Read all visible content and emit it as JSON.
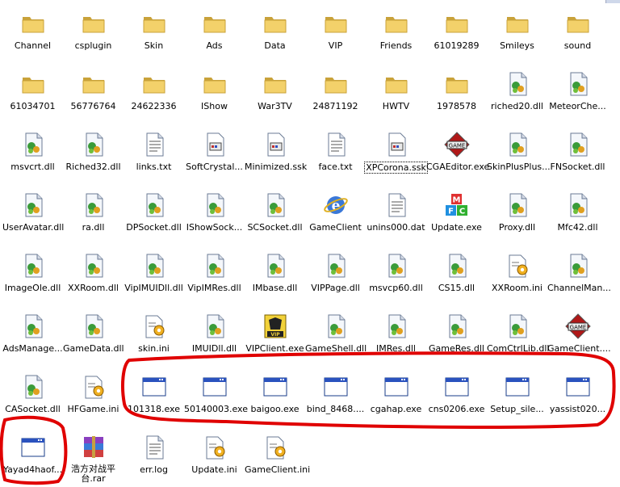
{
  "icons": [
    {
      "name": "Channel",
      "type": "folder"
    },
    {
      "name": "csplugin",
      "type": "folder"
    },
    {
      "name": "Skin",
      "type": "folder"
    },
    {
      "name": "Ads",
      "type": "folder"
    },
    {
      "name": "Data",
      "type": "folder"
    },
    {
      "name": "VIP",
      "type": "folder"
    },
    {
      "name": "Friends",
      "type": "folder"
    },
    {
      "name": "61019289",
      "type": "folder"
    },
    {
      "name": "Smileys",
      "type": "folder"
    },
    {
      "name": "sound",
      "type": "folder"
    },
    {
      "name": "61034701",
      "type": "folder"
    },
    {
      "name": "56776764",
      "type": "folder"
    },
    {
      "name": "24622336",
      "type": "folder"
    },
    {
      "name": "IShow",
      "type": "folder"
    },
    {
      "name": "War3TV",
      "type": "folder"
    },
    {
      "name": "24871192",
      "type": "folder"
    },
    {
      "name": "HWTV",
      "type": "folder"
    },
    {
      "name": "1978578",
      "type": "folder"
    },
    {
      "name": "riched20.dll",
      "type": "dll"
    },
    {
      "name": "MeteorChe...",
      "type": "dll"
    },
    {
      "name": "msvcrt.dll",
      "type": "dll"
    },
    {
      "name": "Riched32.dll",
      "type": "dll"
    },
    {
      "name": "links.txt",
      "type": "txt"
    },
    {
      "name": "SoftCrystal...",
      "type": "skin"
    },
    {
      "name": "Minimized.ssk",
      "type": "skin"
    },
    {
      "name": "face.txt",
      "type": "txt"
    },
    {
      "name": "XPCorona.ssk",
      "type": "skin",
      "selected": true
    },
    {
      "name": "CGAEditor.exe",
      "type": "game"
    },
    {
      "name": "SkinPlusPlus...",
      "type": "dll"
    },
    {
      "name": "FNSocket.dll",
      "type": "dll"
    },
    {
      "name": "UserAvatar.dll",
      "type": "dll"
    },
    {
      "name": "ra.dll",
      "type": "dll"
    },
    {
      "name": "DPSocket.dll",
      "type": "dll"
    },
    {
      "name": "IShowSock...",
      "type": "dll"
    },
    {
      "name": "SCSocket.dll",
      "type": "dll"
    },
    {
      "name": "GameClient",
      "type": "ie"
    },
    {
      "name": "unins000.dat",
      "type": "dat"
    },
    {
      "name": "Update.exe",
      "type": "mfc"
    },
    {
      "name": "Proxy.dll",
      "type": "dll"
    },
    {
      "name": "Mfc42.dll",
      "type": "dll"
    },
    {
      "name": "ImageOle.dll",
      "type": "dll"
    },
    {
      "name": "XXRoom.dll",
      "type": "dll"
    },
    {
      "name": "VipIMUIDll.dll",
      "type": "dll"
    },
    {
      "name": "VipIMRes.dll",
      "type": "dll"
    },
    {
      "name": "IMbase.dll",
      "type": "dll"
    },
    {
      "name": "VIPPage.dll",
      "type": "dll"
    },
    {
      "name": "msvcp60.dll",
      "type": "dll"
    },
    {
      "name": "CS15.dll",
      "type": "dll"
    },
    {
      "name": "XXRoom.ini",
      "type": "ini"
    },
    {
      "name": "ChannelMan...",
      "type": "dll"
    },
    {
      "name": "AdsManage...",
      "type": "dll"
    },
    {
      "name": "GameData.dll",
      "type": "dll"
    },
    {
      "name": "skin.ini",
      "type": "ini"
    },
    {
      "name": "IMUIDll.dll",
      "type": "dll"
    },
    {
      "name": "VIPClient.exe",
      "type": "vip"
    },
    {
      "name": "GameShell.dll",
      "type": "dll"
    },
    {
      "name": "IMRes.dll",
      "type": "dll"
    },
    {
      "name": "GameRes.dll",
      "type": "dll"
    },
    {
      "name": "ComCtrlLib.dll",
      "type": "dll"
    },
    {
      "name": "GameClient....",
      "type": "game"
    },
    {
      "name": "CASocket.dll",
      "type": "dll"
    },
    {
      "name": "HFGame.ini",
      "type": "ini"
    },
    {
      "name": "101318.exe",
      "type": "exe"
    },
    {
      "name": "50140003.exe",
      "type": "exe"
    },
    {
      "name": "baigoo.exe",
      "type": "exe"
    },
    {
      "name": "bind_8468....",
      "type": "exe"
    },
    {
      "name": "cgahap.exe",
      "type": "exe"
    },
    {
      "name": "cns0206.exe",
      "type": "exe"
    },
    {
      "name": "Setup_sile...",
      "type": "exe"
    },
    {
      "name": "yassist020...",
      "type": "exe"
    },
    {
      "name": "Yayad4haof...",
      "type": "exe"
    },
    {
      "name": "浩方对战平台.rar",
      "type": "rar",
      "wrap": true
    },
    {
      "name": "err.log",
      "type": "txt"
    },
    {
      "name": "Update.ini",
      "type": "ini"
    },
    {
      "name": "GameClient.ini",
      "type": "ini"
    }
  ],
  "colors": {
    "folder": "#f3d16a",
    "folder_dark": "#c9a23a",
    "window_title": "#2a52be",
    "annotation": "#e00000"
  }
}
